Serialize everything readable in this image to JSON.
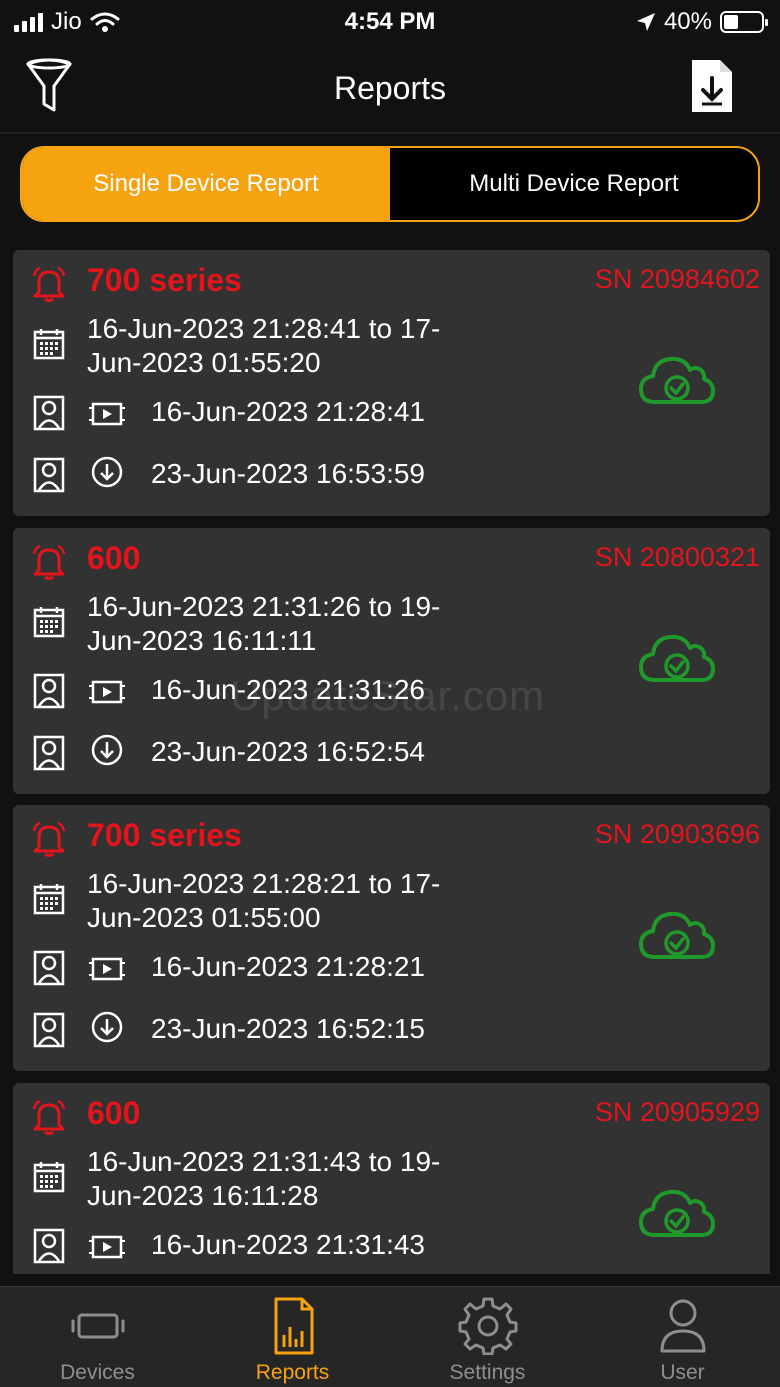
{
  "status_bar": {
    "carrier": "Jio",
    "time": "4:54 PM",
    "battery": "40%",
    "battery_level": 0.4
  },
  "header": {
    "title": "Reports"
  },
  "segments": {
    "single": "Single Device Report",
    "multi": "Multi Device Report"
  },
  "reports": [
    {
      "title": "700 series",
      "sn": "SN 20984602",
      "range_line1": "16-Jun-2023 21:28:41 to 17-",
      "range_line2": "Jun-2023 01:55:20",
      "start": "16-Jun-2023 21:28:41",
      "downloaded": "23-Jun-2023 16:53:59"
    },
    {
      "title": "600",
      "sn": "SN 20800321",
      "range_line1": "16-Jun-2023 21:31:26 to 19-",
      "range_line2": "Jun-2023 16:11:11",
      "start": "16-Jun-2023 21:31:26",
      "downloaded": "23-Jun-2023 16:52:54"
    },
    {
      "title": "700 series",
      "sn": "SN 20903696",
      "range_line1": "16-Jun-2023 21:28:21 to 17-",
      "range_line2": "Jun-2023 01:55:00",
      "start": "16-Jun-2023 21:28:21",
      "downloaded": "23-Jun-2023 16:52:15"
    },
    {
      "title": "600",
      "sn": "SN 20905929",
      "range_line1": "16-Jun-2023 21:31:43 to 19-",
      "range_line2": "Jun-2023 16:11:28",
      "start": "16-Jun-2023 21:31:43"
    }
  ],
  "watermark": "UpdateStar.com",
  "tabs": [
    {
      "label": "Devices",
      "icon": "device-icon"
    },
    {
      "label": "Reports",
      "icon": "reports-icon"
    },
    {
      "label": "Settings",
      "icon": "gear-icon"
    },
    {
      "label": "User",
      "icon": "user-icon"
    }
  ],
  "colors": {
    "accent": "#f6a312",
    "alert_red": "#e3141b",
    "success_green": "#1f9a2a",
    "card_bg": "#323232",
    "app_bg": "#111111"
  }
}
